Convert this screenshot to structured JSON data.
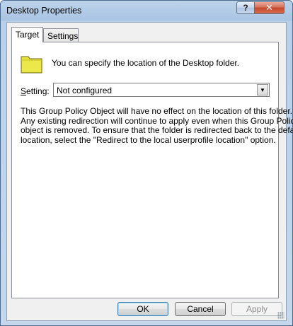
{
  "window": {
    "title": "Desktop Properties",
    "help_label": "?",
    "close_label": "✕"
  },
  "tabs": [
    {
      "label": "Target",
      "selected": true
    },
    {
      "label": "Settings",
      "selected": false
    }
  ],
  "target": {
    "intro": "You can specify the location of the Desktop folder.",
    "setting_label_prefix": "S",
    "setting_label_rest": "etting:",
    "setting_value": "Not configured",
    "description_lines": [
      "This Group Policy Object will have no effect on the location of this folder.",
      "Any existing redirection will continue to apply even when this Group Policy",
      "object is removed. To ensure that the folder is redirected back to the default",
      "location, select the \"Redirect to the local userprofile location\" option."
    ]
  },
  "buttons": {
    "ok": "OK",
    "cancel": "Cancel",
    "apply": "Apply"
  },
  "colors": {
    "folder_fill": "#e8e23a",
    "accent_border": "#3c7fb1"
  }
}
